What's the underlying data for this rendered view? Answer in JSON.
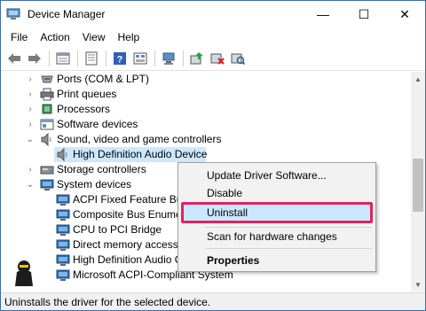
{
  "window": {
    "title": "Device Manager",
    "controls": {
      "minimize": "—",
      "maximize": "☐",
      "close": "✕"
    }
  },
  "menubar": {
    "items": [
      {
        "label": "File"
      },
      {
        "label": "Action"
      },
      {
        "label": "View"
      },
      {
        "label": "Help"
      }
    ]
  },
  "toolbar": {
    "buttons": [
      "back-icon",
      "forward-icon",
      "properties-icon",
      "tree-icon",
      "help-icon",
      "resources-icon",
      "computer-icon",
      "update-driver-icon",
      "uninstall-icon",
      "scan-hardware-icon"
    ]
  },
  "tree": {
    "nodes": [
      {
        "label": "Ports (COM & LPT)",
        "icon": "port-icon",
        "expander": "›"
      },
      {
        "label": "Print queues",
        "icon": "printer-icon",
        "expander": "›"
      },
      {
        "label": "Processors",
        "icon": "processor-icon",
        "expander": "›"
      },
      {
        "label": "Software devices",
        "icon": "software-device-icon",
        "expander": "›"
      },
      {
        "label": "Sound, video and game controllers",
        "icon": "speaker-icon",
        "expander": "⌄"
      },
      {
        "label": "High Definition Audio Device",
        "icon": "speaker-icon",
        "expander": ""
      },
      {
        "label": "Storage controllers",
        "icon": "storage-icon",
        "expander": "›"
      },
      {
        "label": "System devices",
        "icon": "system-device-icon",
        "expander": "⌄"
      },
      {
        "label": "ACPI Fixed Feature Button",
        "icon": "monitor-device-icon",
        "expander": ""
      },
      {
        "label": "Composite Bus Enumerator",
        "icon": "monitor-device-icon",
        "expander": ""
      },
      {
        "label": "CPU to PCI Bridge",
        "icon": "monitor-device-icon",
        "expander": ""
      },
      {
        "label": "Direct memory access controller",
        "icon": "monitor-device-icon",
        "expander": ""
      },
      {
        "label": "High Definition Audio Controller",
        "icon": "monitor-device-icon",
        "expander": ""
      },
      {
        "label": "Microsoft ACPI-Compliant System",
        "icon": "monitor-device-icon",
        "expander": ""
      }
    ]
  },
  "context_menu": {
    "items": [
      {
        "label": "Update Driver Software..."
      },
      {
        "label": "Disable"
      },
      {
        "label": "Uninstall"
      },
      {
        "label": "Scan for hardware changes"
      },
      {
        "label": "Properties"
      }
    ]
  },
  "scrollbar": {
    "up": "▲",
    "down": "▼"
  },
  "statusbar": {
    "text": "Uninstalls the driver for the selected device."
  },
  "colors": {
    "selection": "#cce8ff",
    "highlight_border": "#e0245e",
    "menu_background": "#f2f2f2"
  }
}
